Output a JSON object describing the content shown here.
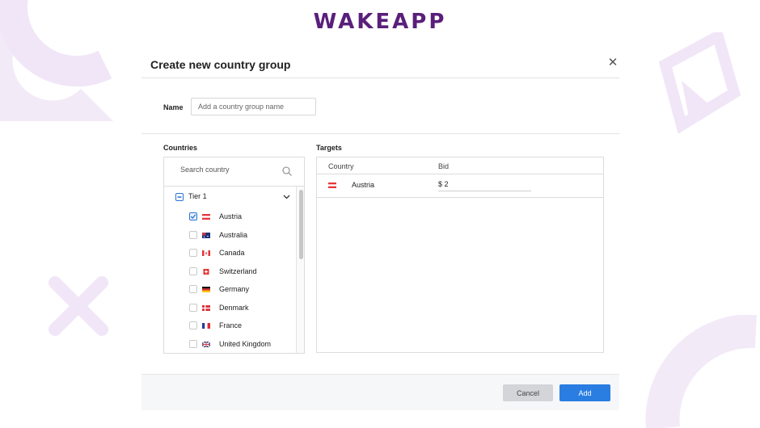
{
  "brand": {
    "logo_text": "WAKEAPP",
    "logo_color": "#5a1f7a",
    "decor_color": "#efe3f5"
  },
  "modal": {
    "title": "Create new country group",
    "close_icon": "close-icon",
    "name": {
      "label": "Name",
      "value": "",
      "placeholder": "Add a country group name"
    },
    "countries": {
      "label": "Countries",
      "search": {
        "placeholder": "Search country",
        "icon": "search-icon"
      },
      "group": {
        "label": "Tier 1",
        "state": "partial",
        "icon": "chevron-down-icon"
      },
      "items": [
        {
          "label": "Austria",
          "checked": true,
          "flag": "austria-flag-icon"
        },
        {
          "label": "Australia",
          "checked": false,
          "flag": "australia-flag-icon"
        },
        {
          "label": "Canada",
          "checked": false,
          "flag": "canada-flag-icon"
        },
        {
          "label": "Switzerland",
          "checked": false,
          "flag": "switzerland-flag-icon"
        },
        {
          "label": "Germany",
          "checked": false,
          "flag": "germany-flag-icon"
        },
        {
          "label": "Denmark",
          "checked": false,
          "flag": "denmark-flag-icon"
        },
        {
          "label": "France",
          "checked": false,
          "flag": "france-flag-icon"
        },
        {
          "label": "United Kingdom",
          "checked": false,
          "flag": "uk-flag-icon"
        }
      ]
    },
    "targets": {
      "label": "Targets",
      "columns": [
        "Country",
        "Bid"
      ],
      "rows": [
        {
          "country": "Austria",
          "flag": "austria-flag-icon",
          "currency": "$",
          "bid": "2"
        }
      ]
    },
    "footer": {
      "cancel_label": "Cancel",
      "add_label": "Add",
      "accent": "#2a7de1"
    }
  }
}
